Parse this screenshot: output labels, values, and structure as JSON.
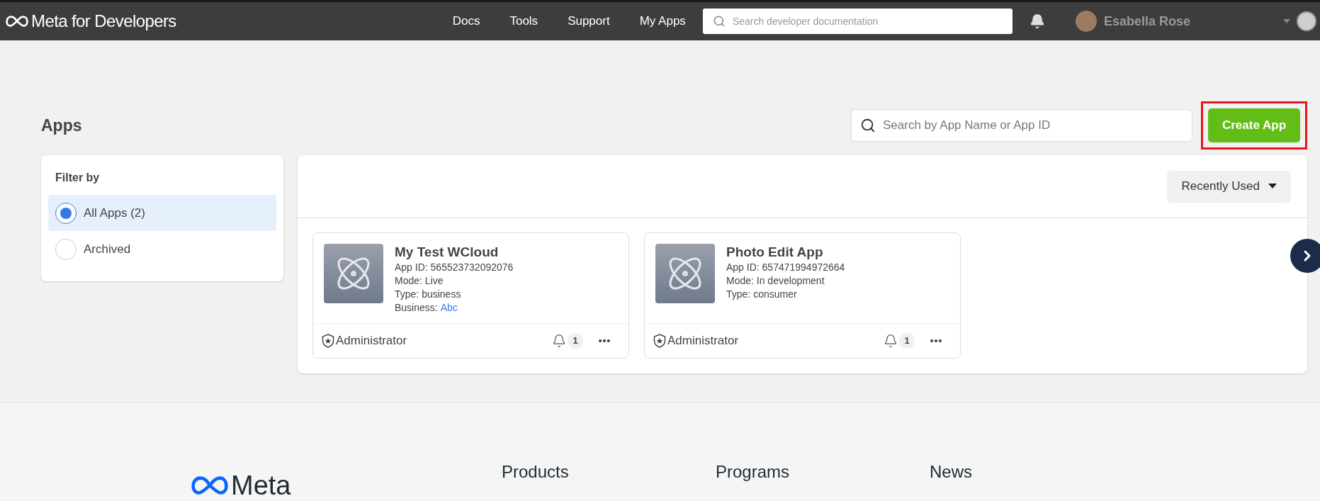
{
  "header": {
    "logo": "Meta for Developers",
    "nav": [
      "Docs",
      "Tools",
      "Support",
      "My Apps"
    ],
    "search": {
      "placeholder": "Search developer documentation"
    },
    "user": {
      "name": "Esabella Rose"
    }
  },
  "page": {
    "title": "Apps",
    "search": {
      "placeholder": "Search by App Name or App ID"
    },
    "create_button": "Create App",
    "create_highlighted": true
  },
  "filter": {
    "title": "Filter by",
    "options": [
      {
        "label": "All Apps (2)",
        "selected": true
      },
      {
        "label": "Archived",
        "selected": false
      }
    ]
  },
  "sort": {
    "label": "Recently Used"
  },
  "apps": [
    {
      "name": "My Test WCloud",
      "fields": [
        {
          "kind": "text",
          "text": "App ID: 565523732092076"
        },
        {
          "kind": "text",
          "text": "Mode: Live"
        },
        {
          "kind": "text",
          "text": "Type: business"
        },
        {
          "kind": "link",
          "text": "Business:",
          "link": "Abc"
        }
      ],
      "role": "Administrator",
      "notifications": "1"
    },
    {
      "name": "Photo Edit App",
      "fields": [
        {
          "kind": "text",
          "text": "App ID: 657471994972664"
        },
        {
          "kind": "text",
          "text": "Mode: In development"
        },
        {
          "kind": "text",
          "text": "Type: consumer"
        }
      ],
      "role": "Administrator",
      "notifications": "1"
    }
  ],
  "footer": {
    "logo": "Meta",
    "columns": [
      "Products",
      "Programs",
      "News"
    ]
  }
}
